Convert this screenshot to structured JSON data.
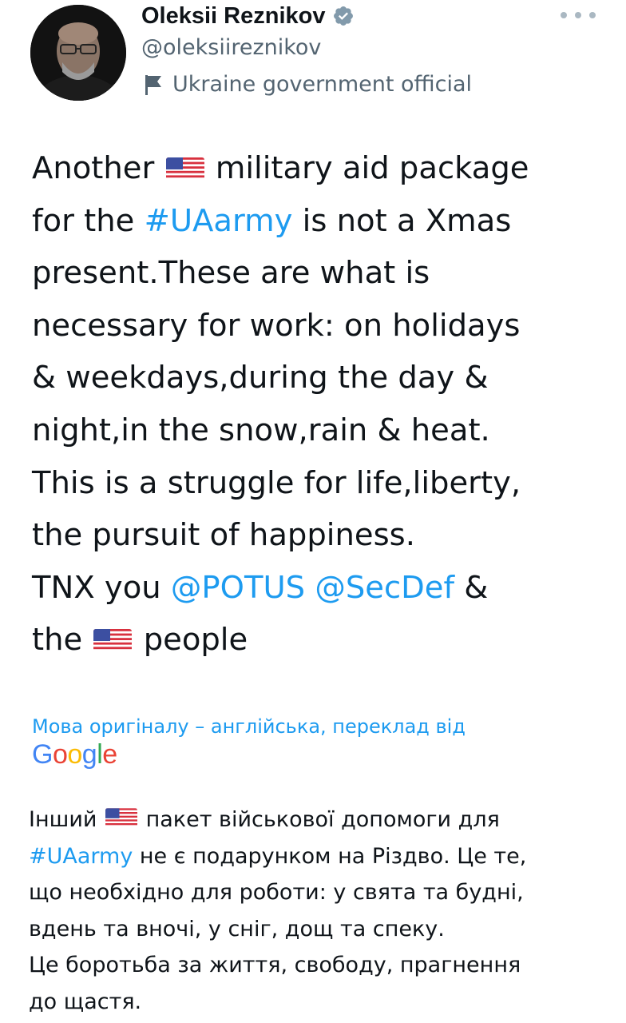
{
  "author": {
    "name": "Oleksii Reznikov",
    "handle": "@oleksiireznikov",
    "label": "Ukraine government official"
  },
  "tweet": {
    "line1": {
      "a": "Another",
      "b": "military aid package"
    },
    "line2": {
      "a": "for the ",
      "hashtag": "#UAarmy",
      "b": " is not a Xmas"
    },
    "line3": "present.These are what is",
    "line4": "necessary for work: on holidays",
    "line5": "& weekdays,during the day &",
    "line6": "night,in the snow,rain & heat.",
    "line7": "This is a struggle for life,liberty,",
    "line8": "the pursuit of happiness.",
    "line9": {
      "a": "TNX you ",
      "mention1": "@POTUS",
      "sp": " ",
      "mention2": "@SecDef",
      "b": " &"
    },
    "line10": {
      "a": "the",
      "b": "people"
    }
  },
  "translation_note": "Мова оригіналу – англійська, переклад від",
  "google_logo": {
    "letters": [
      "G",
      "o",
      "o",
      "g",
      "l",
      "e"
    ],
    "colors": [
      "#4285F4",
      "#EA4335",
      "#FBBC05",
      "#4285F4",
      "#34A853",
      "#EA4335"
    ]
  },
  "translation": {
    "line1": {
      "a": "Інший",
      "b": "пакет військової допомоги для"
    },
    "line2": {
      "hashtag": "#UAarmy",
      "b": " не є подарунком на Різдво. Це те,"
    },
    "line3": "що необхідно для роботи: у свята та будні,",
    "line4": "вдень та вночі, у сніг, дощ та спеку.",
    "line5": "Це боротьба за життя, свободу, прагнення",
    "line6": "до щастя."
  },
  "colors": {
    "link": "#1d9bf0",
    "secondary_text": "#536471",
    "verified_badge": "#829aab"
  },
  "icons": [
    "verified-badge-icon",
    "more-options-icon",
    "government-flag-icon",
    "us-flag-emoji"
  ]
}
